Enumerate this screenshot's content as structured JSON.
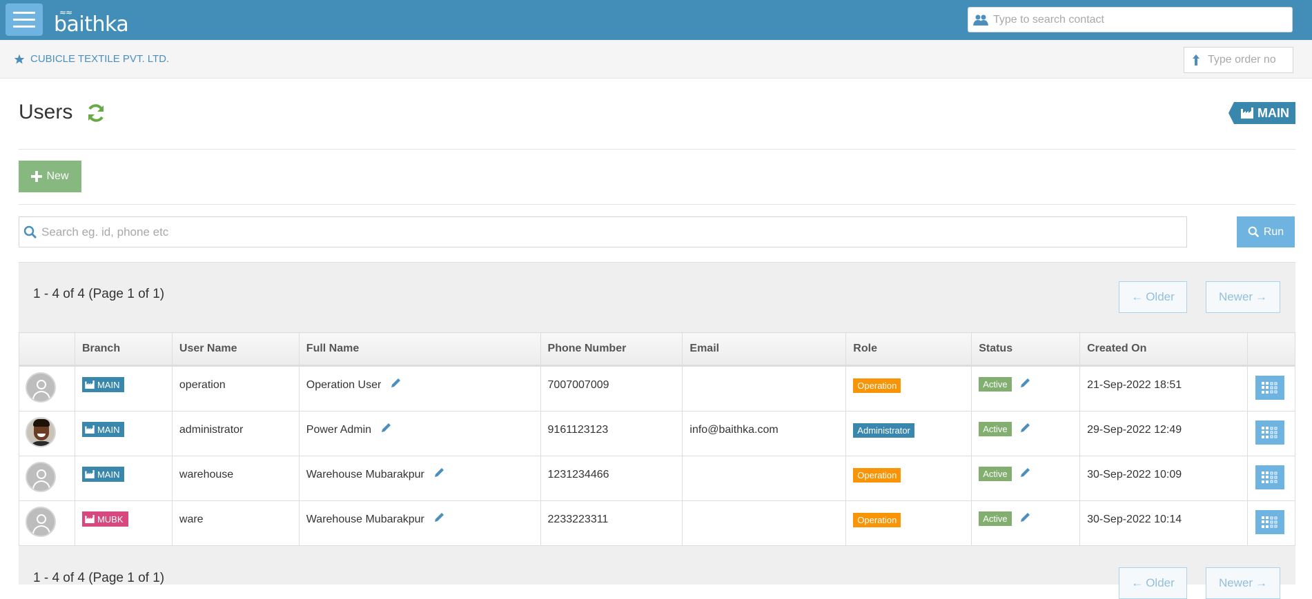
{
  "navbar": {
    "logo_text": "baithka",
    "contact_search_placeholder": "Type to search contact"
  },
  "breadcrumb": {
    "company": "CUBICLE TEXTILE PVT. LTD.",
    "order_placeholder": "Type order no"
  },
  "page": {
    "title": "Users",
    "branch_tag": "MAIN",
    "new_label": "New",
    "search_placeholder": "Search eg. id, phone etc",
    "run_label": "Run"
  },
  "pager": {
    "summary_top": "1 - 4 of 4 (Page 1 of 1)",
    "summary_bottom": "1 - 4 of 4 (Page 1 of 1)",
    "older_label": "Older",
    "newer_label": "Newer"
  },
  "table": {
    "headers": [
      "",
      "Branch",
      "User Name",
      "Full Name",
      "Phone Number",
      "Email",
      "Role",
      "Status",
      "Created On",
      ""
    ],
    "rows": [
      {
        "branch": "MAIN",
        "username": "operation",
        "fullname": "Operation User",
        "phone": "7007007009",
        "email": "",
        "role": "Operation",
        "status": "Active",
        "created": "21-Sep-2022 18:51"
      },
      {
        "branch": "MAIN",
        "username": "administrator",
        "fullname": "Power Admin",
        "phone": "9161123123",
        "email": "info@baithka.com",
        "role": "Administrator",
        "status": "Active",
        "created": "29-Sep-2022 12:49"
      },
      {
        "branch": "MAIN",
        "username": "warehouse",
        "fullname": "Warehouse Mubarakpur",
        "phone": "1231234466",
        "email": "",
        "role": "Operation",
        "status": "Active",
        "created": "30-Sep-2022 10:09"
      },
      {
        "branch": "MUBK",
        "username": "ware",
        "fullname": "Warehouse Mubarakpur",
        "phone": "2233223311",
        "email": "",
        "role": "Operation",
        "status": "Active",
        "created": "30-Sep-2022 10:14"
      }
    ]
  },
  "colors": {
    "navbar": "#438eb9",
    "accent": "#6fb3e0",
    "new_button": "#87b87f",
    "branch_main": "#3a87ad",
    "branch_mubk": "#d6487e",
    "role_operation": "#f89406",
    "role_admin": "#3a87ad",
    "status_active": "#82af6f",
    "refresh_icon": "#69aa46"
  },
  "icons": [
    "menu-icon",
    "contacts-icon",
    "star-icon",
    "order-arrow-icon",
    "refresh-icon",
    "building-icon",
    "plus-icon",
    "search-icon",
    "arrow-left-icon",
    "arrow-right-icon",
    "user-avatar",
    "pencil-icon",
    "grid-actions-icon"
  ]
}
